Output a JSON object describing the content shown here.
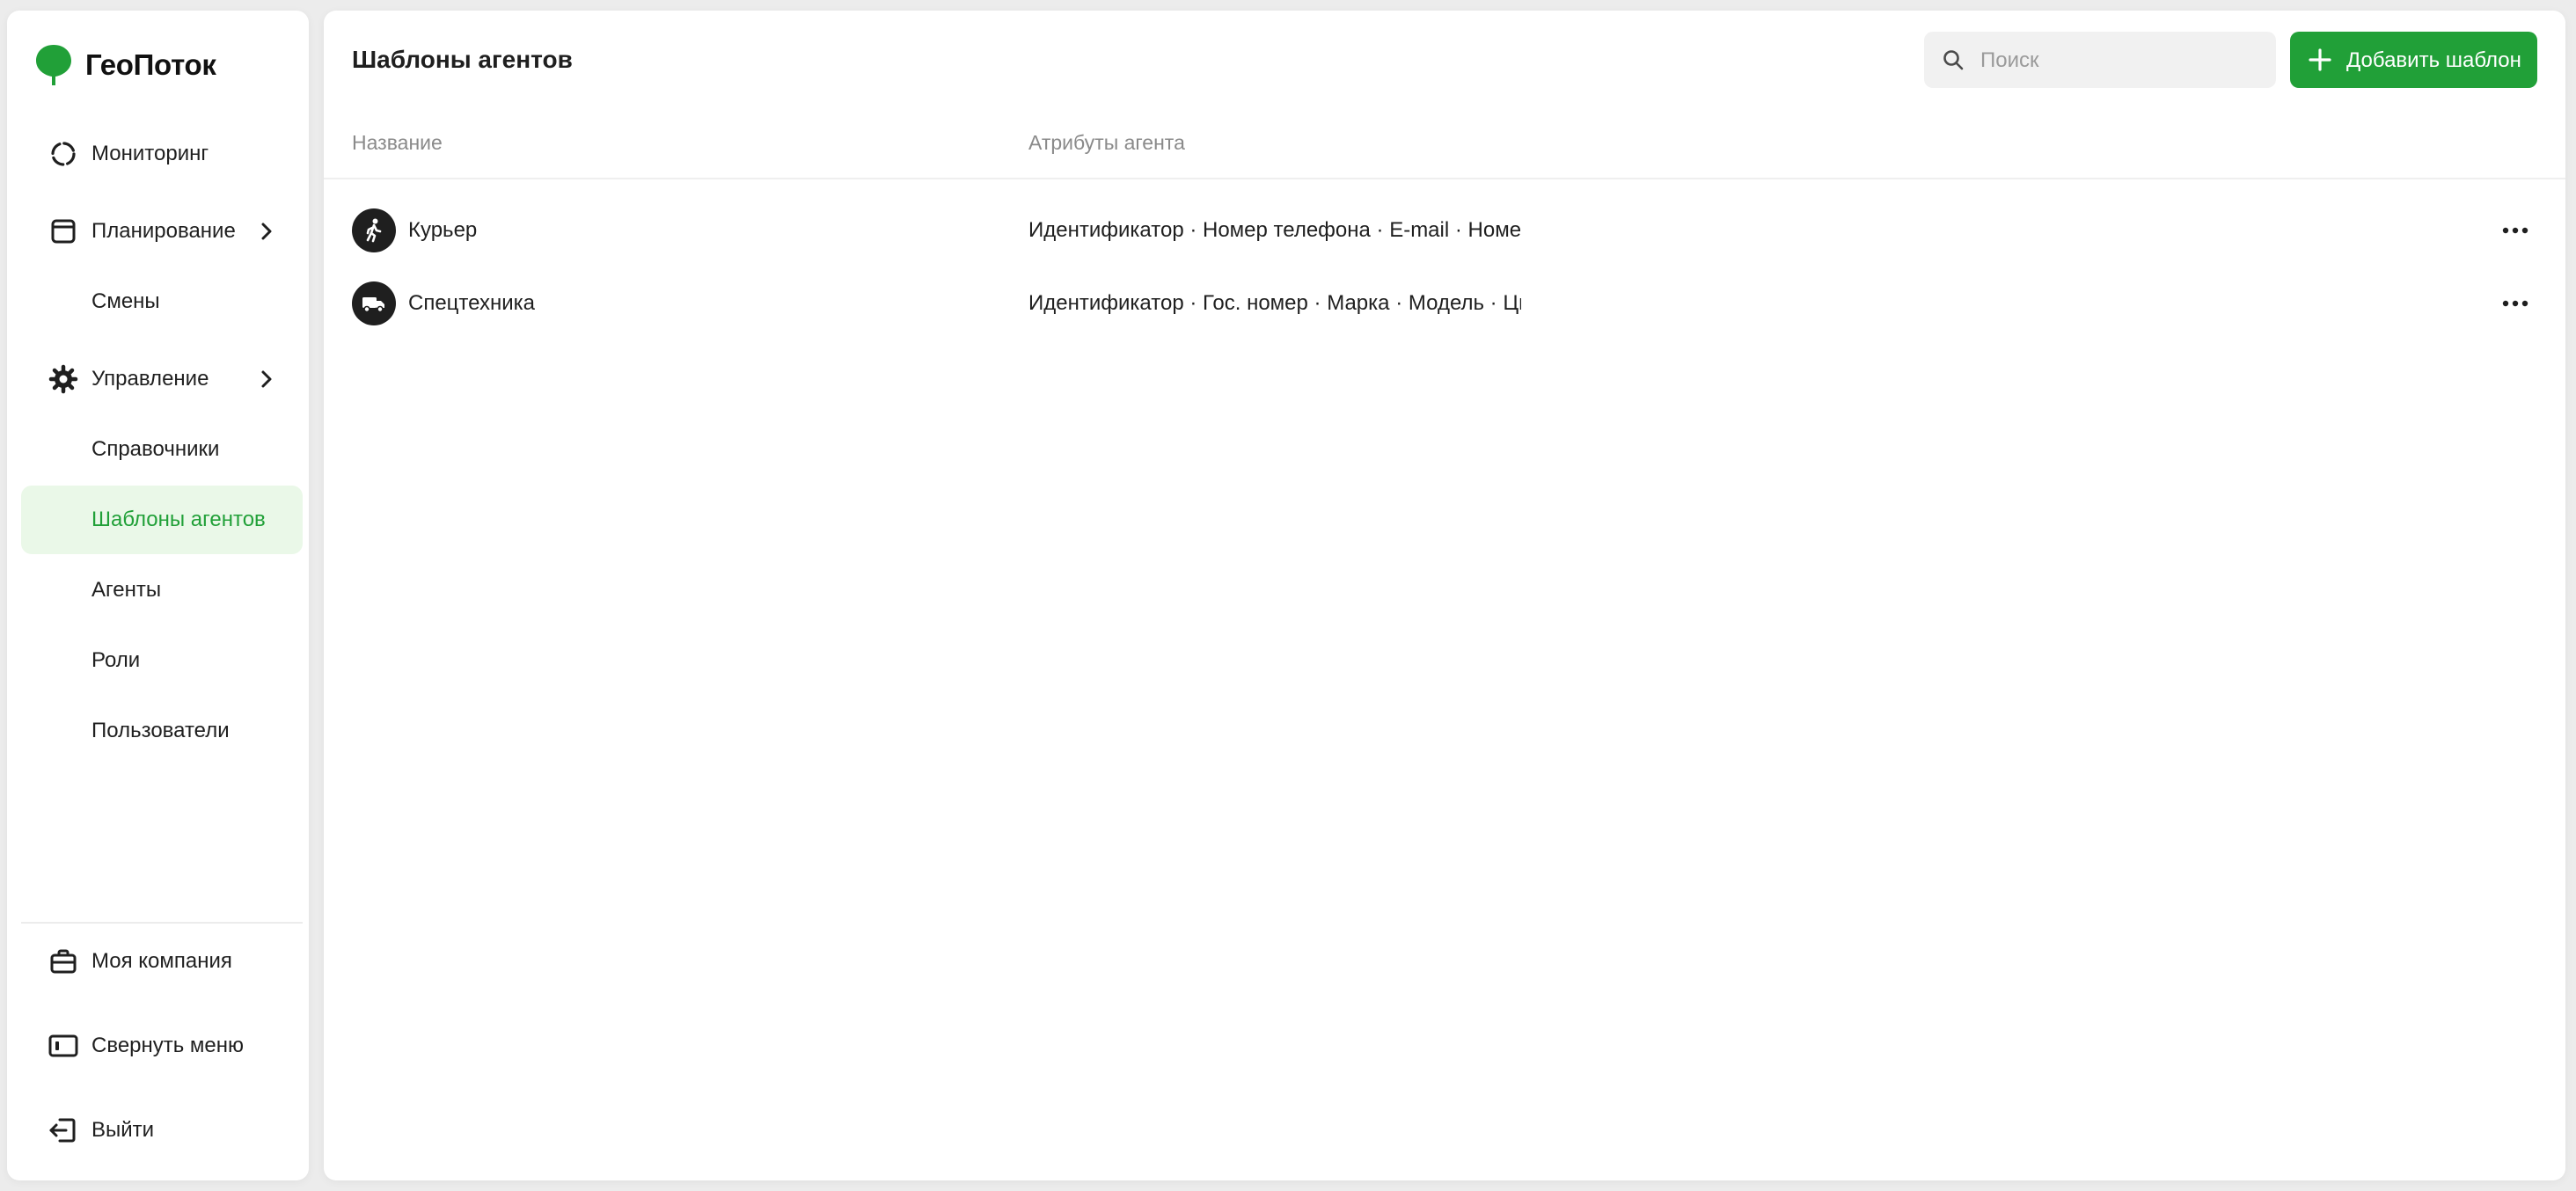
{
  "brand": {
    "name": "ГеоПоток",
    "accent": "#21a038"
  },
  "sidebar": {
    "items": [
      {
        "label": "Мониторинг",
        "icon": "monitoring-icon"
      },
      {
        "label": "Планирование",
        "icon": "calendar-icon",
        "expandable": true
      },
      {
        "label": "Смены"
      },
      {
        "label": "Управление",
        "icon": "gear-icon",
        "expandable": true
      },
      {
        "label": "Справочники"
      },
      {
        "label": "Шаблоны агентов",
        "active": true
      },
      {
        "label": "Агенты"
      },
      {
        "label": "Роли"
      },
      {
        "label": "Пользователи"
      }
    ],
    "footer": [
      {
        "label": "Моя компания",
        "icon": "briefcase-icon"
      },
      {
        "label": "Свернуть меню",
        "icon": "collapse-sidebar-icon"
      },
      {
        "label": "Выйти",
        "icon": "logout-icon"
      }
    ]
  },
  "main": {
    "title": "Шаблоны агентов",
    "search": {
      "placeholder": "Поиск",
      "value": ""
    },
    "add_button": "Добавить шаблон",
    "table": {
      "columns": [
        "Название",
        "Атрибуты агента"
      ],
      "rows": [
        {
          "name": "Курьер",
          "icon": "walking-person-icon",
          "attributes": "Идентификатор · Номер телефона · E-mail · Номер"
        },
        {
          "name": "Спецтехника",
          "icon": "truck-icon",
          "attributes": "Идентификатор · Гос. номер · Марка · Модель · Цвет"
        }
      ]
    }
  }
}
